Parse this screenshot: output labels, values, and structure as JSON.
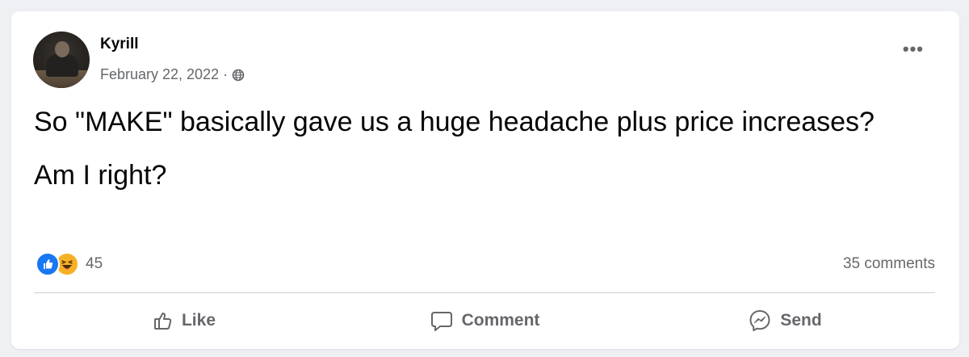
{
  "post": {
    "author": "Kyrill",
    "date": "February 22, 2022",
    "separator": "·",
    "audience_icon": "globe-icon",
    "more_icon": "more-options-icon",
    "more_label": "•••",
    "paragraphs": [
      "So \"MAKE\" basically gave us a huge headache plus price increases?",
      "Am I right?"
    ]
  },
  "reactions": {
    "types": [
      "like-icon",
      "haha-icon"
    ],
    "count": "45",
    "comments": "35 comments"
  },
  "actions": {
    "like": "Like",
    "comment": "Comment",
    "send": "Send"
  },
  "colors": {
    "like_blue": "#1877f2",
    "haha_yellow": "#f7b125",
    "secondary_text": "#65676b",
    "primary_text": "#050505"
  }
}
